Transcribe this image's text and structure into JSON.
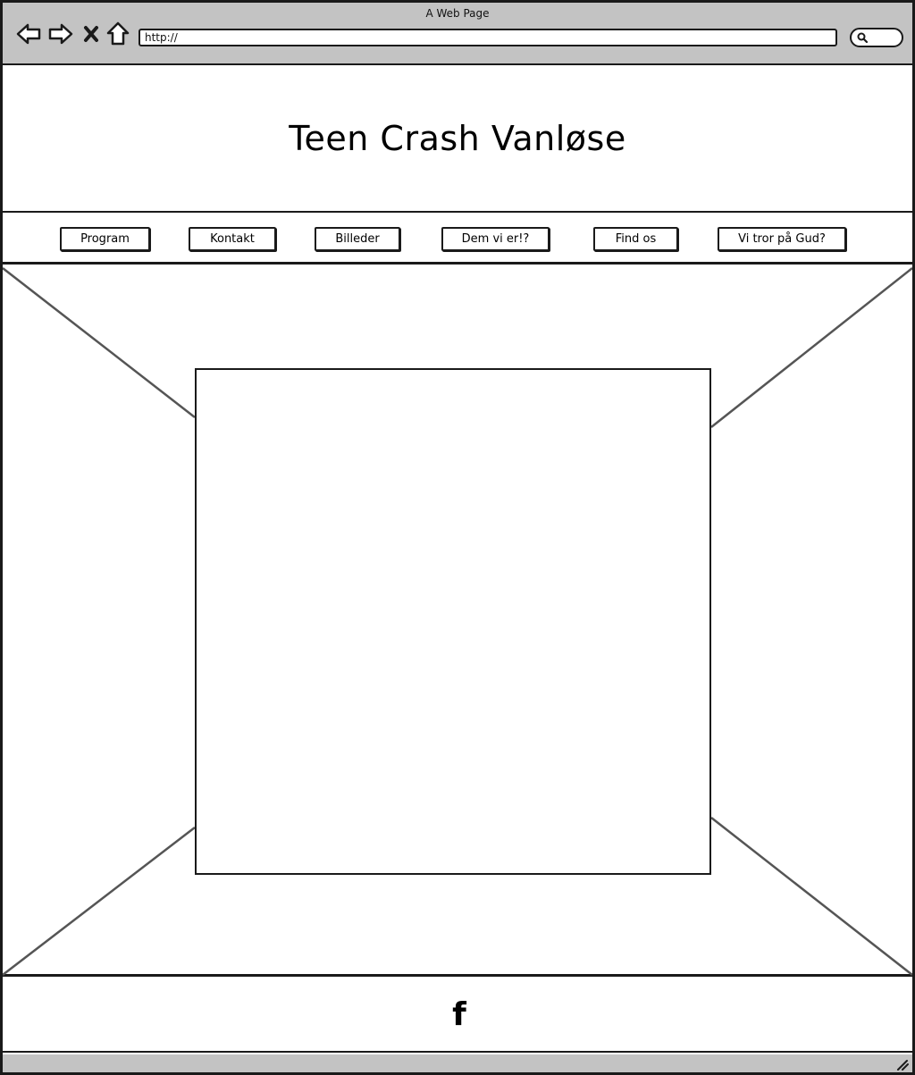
{
  "browser": {
    "title": "A Web Page",
    "url": "http://",
    "icons": [
      "back-arrow-icon",
      "forward-arrow-icon",
      "stop-x-icon",
      "home-icon",
      "search-icon",
      "resize-grip-icon"
    ]
  },
  "header": {
    "site_title": "Teen Crash Vanløse"
  },
  "nav": {
    "items": [
      {
        "label": "Program"
      },
      {
        "label": "Kontakt"
      },
      {
        "label": "Billeder"
      },
      {
        "label": "Dem vi er!?"
      },
      {
        "label": "Find os"
      },
      {
        "label": "Vi tror på Gud?"
      }
    ]
  },
  "footer": {
    "facebook_glyph": "f",
    "icon": "facebook-icon"
  },
  "colors": {
    "chrome": "#c3c3c3",
    "stroke": "#1a1a1a",
    "background": "#ffffff"
  }
}
